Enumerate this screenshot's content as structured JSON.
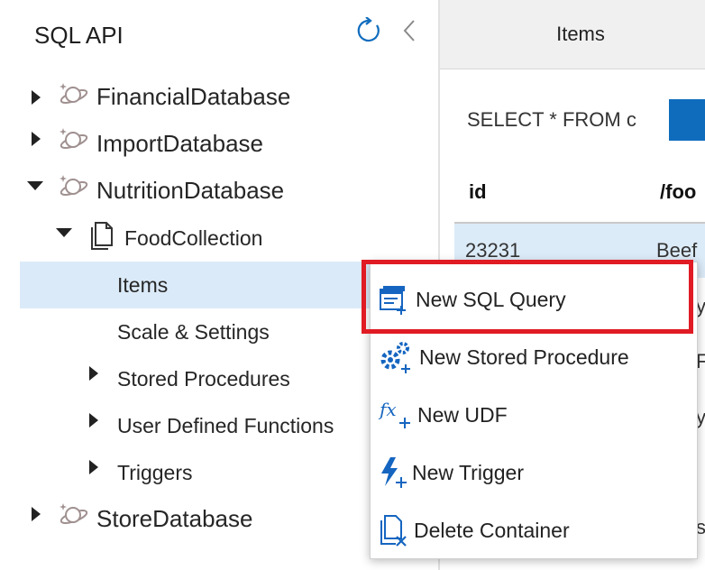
{
  "sidebar": {
    "title": "SQL API",
    "tree": {
      "db1": "FinancialDatabase",
      "db2": "ImportDatabase",
      "db3": "NutritionDatabase",
      "collection": "FoodCollection",
      "items": "Items",
      "scale": "Scale & Settings",
      "stored_procedures": "Stored Procedures",
      "udfs": "User Defined Functions",
      "triggers": "Triggers",
      "db4": "StoreDatabase"
    }
  },
  "main": {
    "tab_label": "Items",
    "query": "SELECT * FROM c",
    "columns": [
      "id",
      "/foo"
    ],
    "row": {
      "id": "23231",
      "food": "Beef"
    },
    "peek_chars": [
      "y",
      "F",
      "y",
      "",
      "s"
    ]
  },
  "context_menu": {
    "items": [
      "New SQL Query",
      "New Stored Procedure",
      "New UDF",
      "New Trigger",
      "Delete Container"
    ]
  },
  "colors": {
    "accent": "#0f6cbd",
    "selected_row": "#dbeaf8",
    "highlight": "#e01b24"
  },
  "icons": [
    "refresh-icon",
    "collapse-icon",
    "database-icon",
    "collection-icon",
    "new-sql-query-icon",
    "stored-procedure-icon",
    "udf-icon",
    "trigger-icon",
    "delete-container-icon"
  ]
}
